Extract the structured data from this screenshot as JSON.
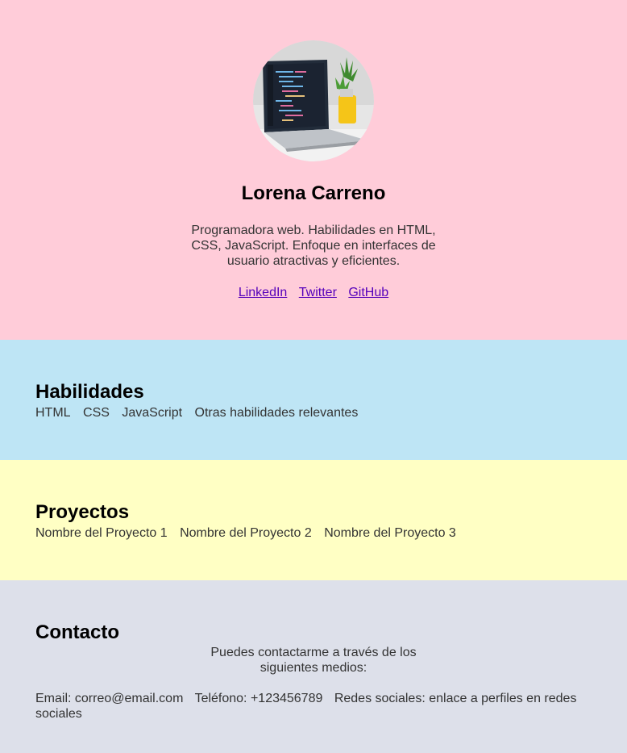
{
  "profile": {
    "name": "Lorena Carreno",
    "bio": "Programadora web. Habilidades en HTML, CSS, JavaScript. Enfoque en interfaces de usuario atractivas y eficientes.",
    "links": [
      "LinkedIn",
      "Twitter",
      "GitHub"
    ],
    "avatar_icon": "laptop-with-code-photo"
  },
  "skills": {
    "title": "Habilidades",
    "items": [
      "HTML",
      "CSS",
      "JavaScript",
      "Otras habilidades relevantes"
    ]
  },
  "projects": {
    "title": "Proyectos",
    "items": [
      "Nombre del Proyecto 1",
      "Nombre del Proyecto 2",
      "Nombre del Proyecto 3"
    ]
  },
  "contact": {
    "title": "Contacto",
    "intro": "Puedes contactarme a través de los siguientes medios:",
    "email": "Email: correo@email.com",
    "phone": "Teléfono: +123456789",
    "social": "Redes sociales: enlace a perfiles en redes sociales"
  },
  "colors": {
    "hero_bg": "#ffccd9",
    "skills_bg": "#bee5f5",
    "projects_bg": "#ffffc4",
    "contact_bg": "#dde0ea",
    "link": "#5500bb"
  }
}
